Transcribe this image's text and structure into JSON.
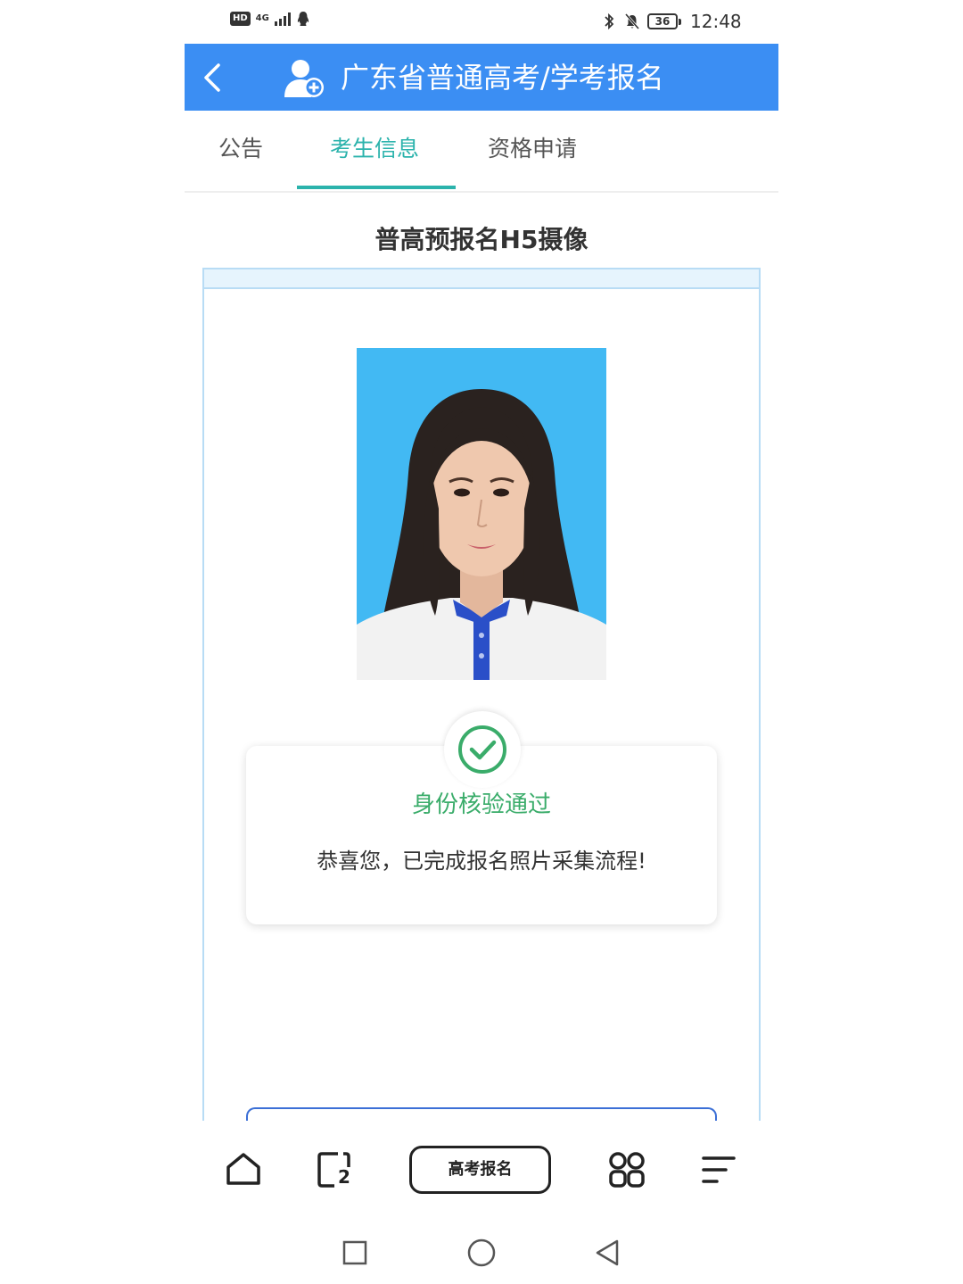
{
  "status_bar": {
    "hd_badge": "HD",
    "network": "4G",
    "battery": "36",
    "time": "12:48"
  },
  "header": {
    "title": "广东省普通高考/学考报名",
    "back_icon": "chevron-left-icon",
    "user_icon": "user-add-icon"
  },
  "tabs": [
    {
      "label": "公告",
      "active": false
    },
    {
      "label": "考生信息",
      "active": true
    },
    {
      "label": "资格申请",
      "active": false
    }
  ],
  "page": {
    "title": "普高预报名H5摄像"
  },
  "result": {
    "icon": "check-circle-icon",
    "title": "身份核验通过",
    "message": "恭喜您，已完成报名照片采集流程!"
  },
  "browser_bar": {
    "home_icon": "home-icon",
    "tabs_icon": "tabs-icon",
    "tabs_count": "2",
    "center_label": "高考报名",
    "apps_icon": "apps-grid-icon",
    "menu_icon": "menu-icon"
  },
  "system_nav": {
    "recents_icon": "square-icon",
    "home_icon": "circle-icon",
    "back_icon": "triangle-back-icon"
  },
  "colors": {
    "header_blue": "#3b8ef3",
    "tab_active": "#2bb3ac",
    "success_green": "#3aac6a",
    "photo_bg": "#42b9f3"
  }
}
